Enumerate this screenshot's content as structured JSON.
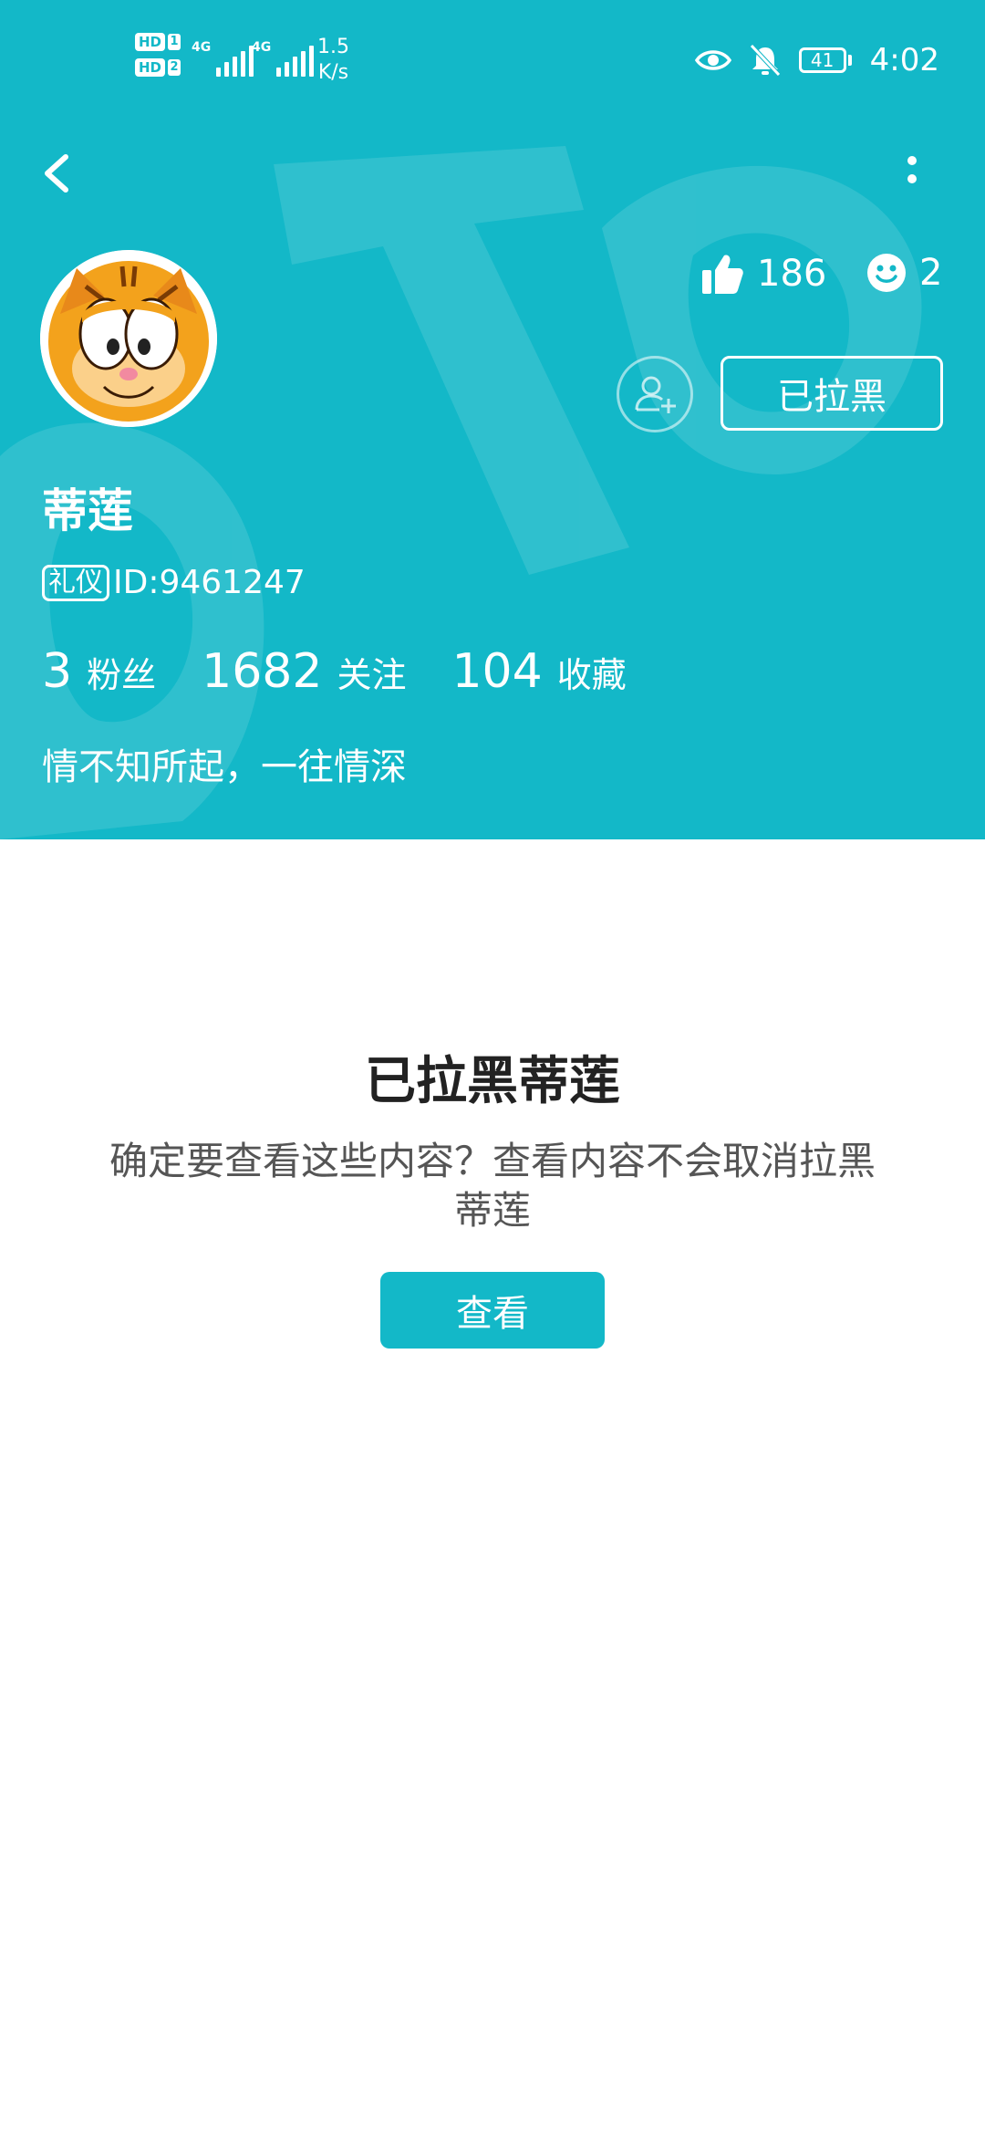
{
  "status_bar": {
    "sim1_label": "HD",
    "sim1_slot": "1",
    "sim2_label": "HD",
    "sim2_slot": "2",
    "net1": "4G",
    "net2": "4G",
    "speed_value": "1.5",
    "speed_unit": "K/s",
    "battery": "41",
    "time": "4:02",
    "icons": [
      "eye-icon",
      "bell-off-icon"
    ]
  },
  "header": {
    "back_icon": "back-arrow-icon",
    "more_icon": "more-vertical-icon",
    "bg_color": "#13b8c8"
  },
  "profile": {
    "likes": "186",
    "smiles": "2",
    "blocked_button": "已拉黑",
    "username": "蒂莲",
    "tag": "礼仪",
    "id": "ID:9461247",
    "fans_count": "3",
    "fans_label": "粉丝",
    "following_count": "1682",
    "following_label": "关注",
    "favorites_count": "104",
    "favorites_label": "收藏",
    "bio": "情不知所起，一往情深"
  },
  "notice": {
    "title": "已拉黑蒂莲",
    "description": "确定要查看这些内容？查看内容不会取消拉黑蒂莲",
    "view_button": "查看",
    "accent_color": "#13b8c8"
  }
}
